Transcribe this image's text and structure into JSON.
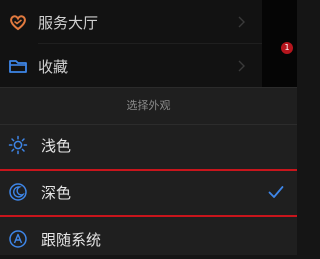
{
  "menu": {
    "items": [
      {
        "label": "服务大厅",
        "icon": "heart-hands-icon"
      },
      {
        "label": "收藏",
        "icon": "folder-icon"
      }
    ],
    "badge": "1"
  },
  "sheet": {
    "title": "选择外观",
    "options": [
      {
        "label": "浅色",
        "icon": "sun-icon",
        "selected": false
      },
      {
        "label": "深色",
        "icon": "moon-icon",
        "selected": true
      },
      {
        "label": "跟随系统",
        "icon": "auto-icon",
        "selected": false
      }
    ]
  },
  "colors": {
    "accent": "#3e86e8",
    "highlight": "#c8151c",
    "icon_orange": "#e27a3f",
    "icon_blue": "#3e86e8"
  }
}
